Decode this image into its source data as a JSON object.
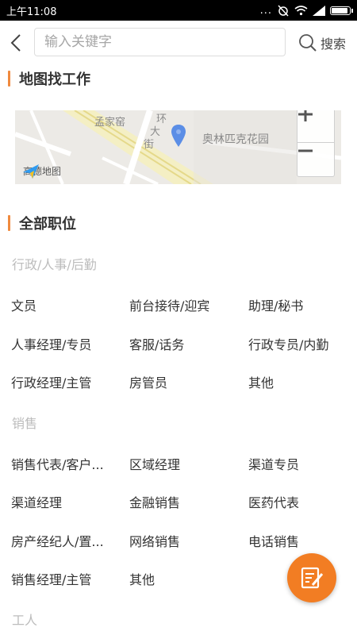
{
  "status_bar": {
    "time": "上午11:08",
    "dots": "..."
  },
  "search": {
    "placeholder": "输入关键字",
    "button_label": "搜索"
  },
  "map_section": {
    "title": "地图找工作",
    "labels": {
      "meng": "孟家窑",
      "huan": "环",
      "da": "大",
      "jie": "街",
      "olympic": "奥林匹克花园"
    },
    "provider": "高德地图",
    "zoom_in": "+",
    "zoom_out": "−"
  },
  "jobs_section": {
    "title": "全部职位",
    "categories": [
      {
        "name": "行政/人事/后勤",
        "items": [
          "文员",
          "前台接待/迎宾",
          "助理/秘书",
          "人事经理/专员",
          "客服/话务",
          "行政专员/内勤",
          "行政经理/主管",
          "房管员",
          "其他"
        ]
      },
      {
        "name": "销售",
        "items": [
          "销售代表/客户...",
          "区域经理",
          "渠道专员",
          "渠道经理",
          "金融销售",
          "医药代表",
          "房产经纪人/置...",
          "网络销售",
          "电话销售",
          "销售经理/主管",
          "其他"
        ]
      },
      {
        "name": "工人",
        "items": []
      }
    ]
  },
  "colors": {
    "accent": "#f08a3e",
    "fab": "#f27d23",
    "map_pin": "#5b8ee6"
  }
}
